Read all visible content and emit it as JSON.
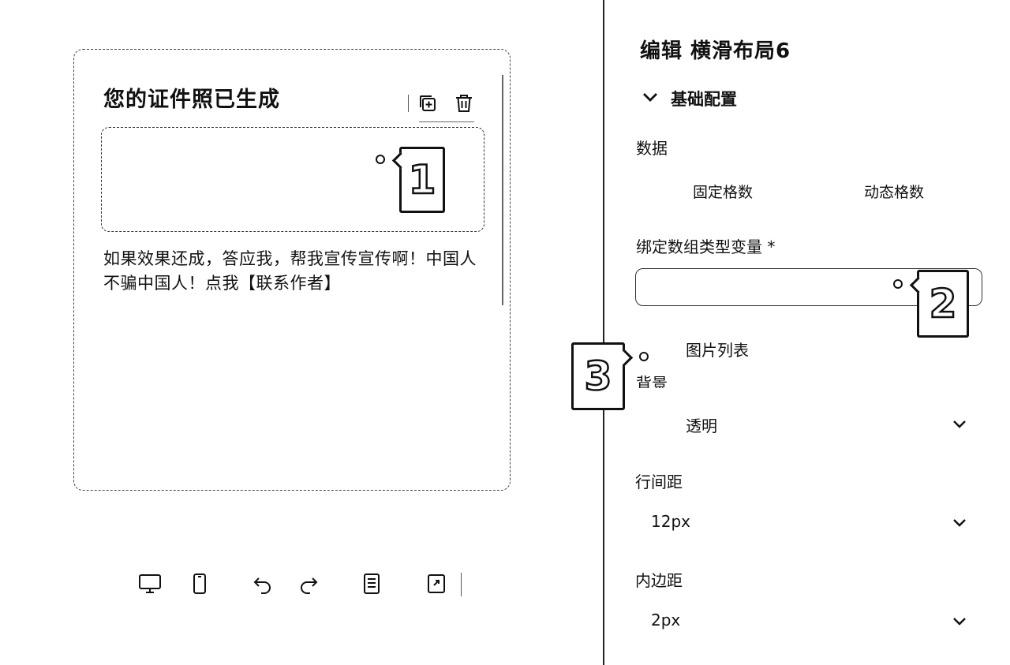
{
  "preview": {
    "title": "您的证件照已生成",
    "text": "如果效果还成，答应我，帮我宣传宣传啊！中国人不骗中国人！点我【联系作者】",
    "toolbar_icons": [
      "copy-add-icon",
      "trash-icon"
    ]
  },
  "bottom_toolbar": {
    "icons": [
      "desktop-icon",
      "mobile-icon",
      "undo-icon",
      "redo-icon",
      "document-icon",
      "export-icon"
    ]
  },
  "panel": {
    "title": "编辑 横滑布局6",
    "section": "基础配置",
    "data_label": "数据",
    "data_options": [
      "固定格数",
      "动态格数"
    ],
    "bind_label": "绑定数组类型变量 *",
    "bind_value": "",
    "image_list_label": "图片列表",
    "background_label": "背景",
    "background_value": "透明",
    "line_spacing_label": "行间距",
    "line_spacing_value": "12px",
    "padding_label": "内边距",
    "padding_value": "2px"
  },
  "callouts": [
    "1",
    "2",
    "3"
  ]
}
